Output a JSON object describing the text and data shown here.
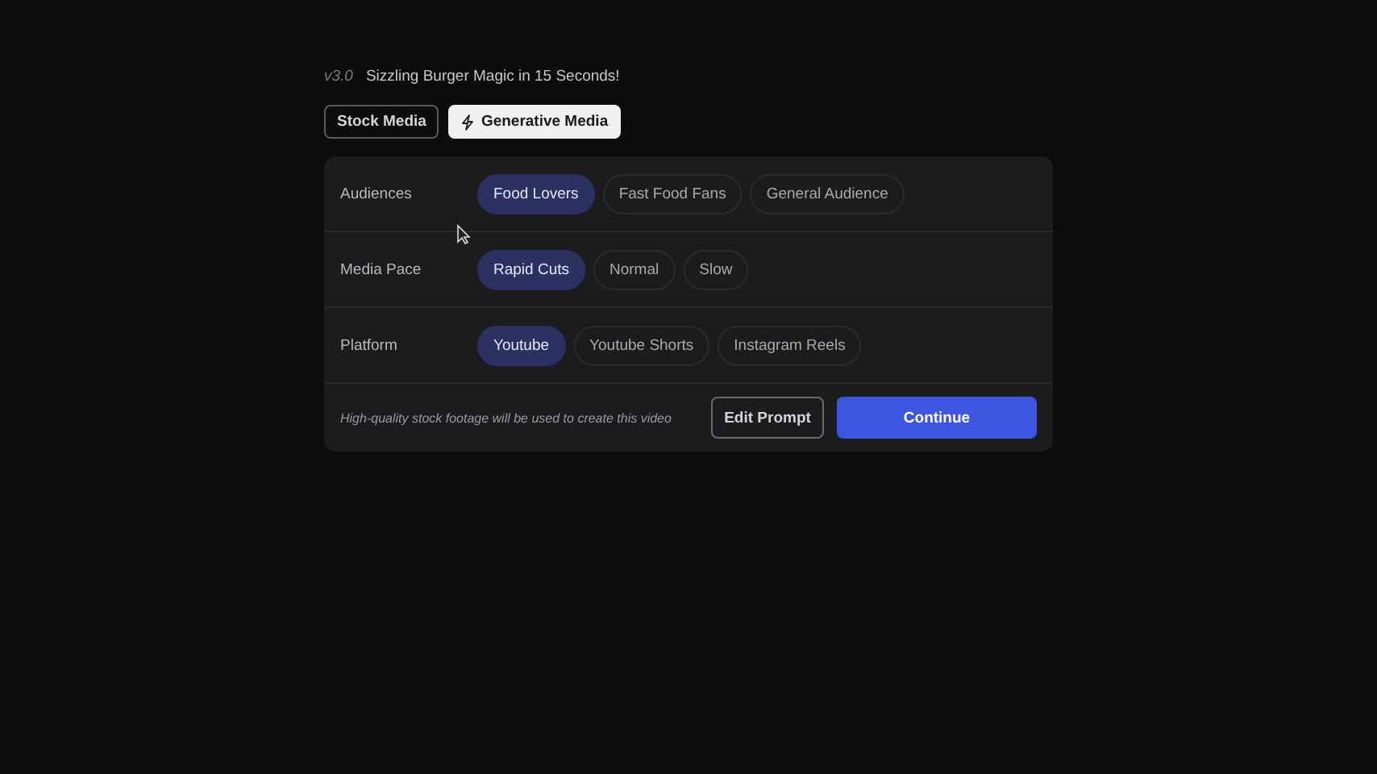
{
  "header": {
    "version": "v3.0",
    "title": "Sizzling Burger Magic in 15 Seconds!"
  },
  "modes": [
    {
      "label": "Stock Media",
      "selected": false,
      "icon": false
    },
    {
      "label": "Generative Media",
      "selected": true,
      "icon": true
    }
  ],
  "options": [
    {
      "label": "Audiences",
      "choices": [
        {
          "label": "Food Lovers",
          "selected": true
        },
        {
          "label": "Fast Food Fans",
          "selected": false
        },
        {
          "label": "General Audience",
          "selected": false
        }
      ]
    },
    {
      "label": "Media Pace",
      "choices": [
        {
          "label": "Rapid Cuts",
          "selected": true
        },
        {
          "label": "Normal",
          "selected": false
        },
        {
          "label": "Slow",
          "selected": false
        }
      ]
    },
    {
      "label": "Platform",
      "choices": [
        {
          "label": "Youtube",
          "selected": true
        },
        {
          "label": "Youtube Shorts",
          "selected": false
        },
        {
          "label": "Instagram Reels",
          "selected": false
        }
      ]
    }
  ],
  "footer": {
    "note": "High-quality stock footage will be used to create this video",
    "buttons": [
      {
        "label": "Edit Prompt",
        "kind": "secondary"
      },
      {
        "label": "Continue",
        "kind": "primary"
      }
    ]
  }
}
